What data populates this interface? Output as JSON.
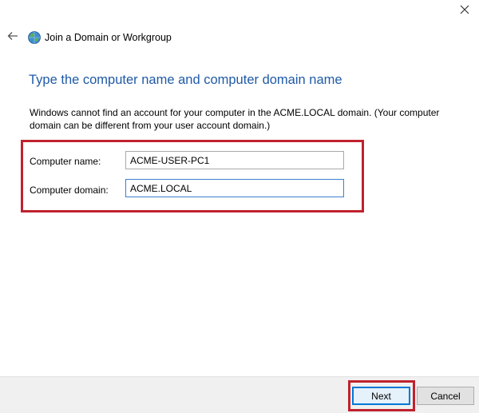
{
  "window": {
    "title": "Join a Domain or Workgroup"
  },
  "icons": {
    "close": "close-icon",
    "back": "back-arrow-icon",
    "app": "network-globe-icon"
  },
  "heading": "Type the computer name and computer domain name",
  "message": "Windows cannot find an account for your computer in the ACME.LOCAL domain. (Your computer domain can be different from your user account domain.)",
  "form": {
    "computer_name": {
      "label": "Computer name:",
      "value": "ACME-USER-PC1"
    },
    "computer_domain": {
      "label": "Computer domain:",
      "value": "ACME.LOCAL"
    }
  },
  "buttons": {
    "next": "Next",
    "cancel": "Cancel"
  },
  "colors": {
    "heading": "#1f5aa6",
    "highlight": "#c0212e",
    "accent": "#0078d7",
    "footer": "#f0f0f0"
  }
}
